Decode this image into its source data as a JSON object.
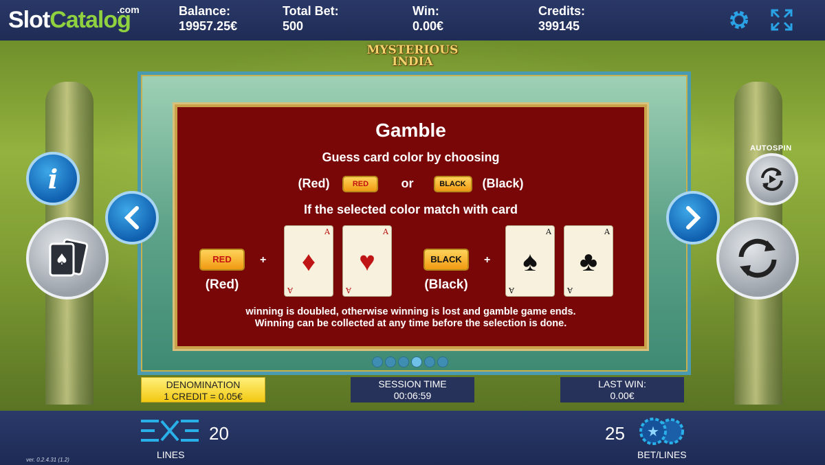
{
  "brand": {
    "slot": "Slot",
    "catalog": "Catalog",
    "com": ".com"
  },
  "header": {
    "balance": {
      "label": "Balance:",
      "value": "19957.25€"
    },
    "total_bet": {
      "label": "Total Bet:",
      "value": "500"
    },
    "win": {
      "label": "Win:",
      "value": "0.00€"
    },
    "credits": {
      "label": "Credits:",
      "value": "399145"
    },
    "icons": [
      "gear-icon",
      "fullscreen-icon"
    ]
  },
  "game_logo": {
    "line1": "MYSTERIOUS",
    "line2": "INDIA"
  },
  "gamble": {
    "title": "Gamble",
    "subtitle": "Guess card color by choosing",
    "red_label": "(Red)",
    "or_text": "or",
    "black_label": "(Black)",
    "red_chip": "RED",
    "black_chip": "BLACK",
    "match_text": "If the selected color match with card",
    "plus": "+",
    "card_rank": "A",
    "footer1": "winning is doubled, otherwise winning is lost and gamble game ends.",
    "footer2": "Winning can be collected at any time before the selection is done."
  },
  "page_dots": {
    "count": 6,
    "active": 3
  },
  "autospin_label": "AUTOSPIN",
  "info": {
    "denomination_label": "DENOMINATION",
    "denomination_value": "1 CREDIT = 0.05€",
    "session_label": "SESSION TIME",
    "session_value": "00:06:59",
    "lastwin_label": "LAST WIN:",
    "lastwin_value": "0.00€"
  },
  "bottom": {
    "lines_value": "20",
    "lines_label": "LINES",
    "bet_value": "25",
    "bet_label": "BET/LINES",
    "version": "ver. 0.2.4.31 (1.2)"
  },
  "colors": {
    "accent_blue": "#1f7fd0",
    "brand_green": "#8fd13f",
    "panel_red": "#7a0707",
    "chip_gold": "#f2c812"
  }
}
